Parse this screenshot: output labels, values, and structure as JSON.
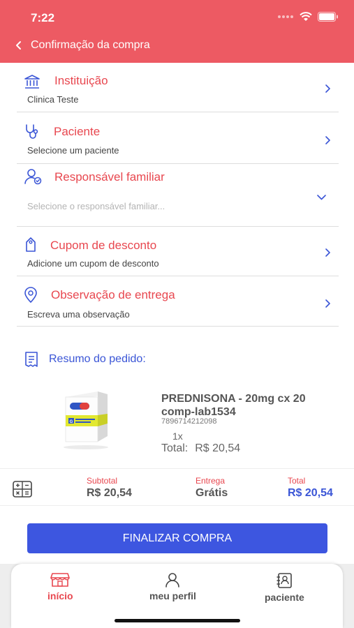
{
  "status_bar": {
    "time": "7:22"
  },
  "header": {
    "title": "Confirmação da compra"
  },
  "sections": {
    "institution": {
      "title": "Instituição",
      "value": "Clinica Teste"
    },
    "patient": {
      "title": "Paciente",
      "value": "Selecione um paciente"
    },
    "guardian": {
      "title": "Responsável familiar",
      "placeholder": "Selecione o responsável familiar..."
    },
    "coupon": {
      "title": "Cupom de desconto",
      "value": "Adicione um cupom de desconto"
    },
    "delivery_note": {
      "title": "Observação de entrega",
      "value": "Escreva uma observação"
    }
  },
  "summary": {
    "title": "Resumo do pedido:",
    "product": {
      "name": "PREDNISONA - 20mg cx 20 comp-lab1534",
      "code": "7896714212098",
      "quantity": "1x",
      "total_label": "Total:",
      "total_value": "R$ 20,54"
    }
  },
  "totals": {
    "subtotal_label": "Subtotal",
    "subtotal_value": "R$ 20,54",
    "delivery_label": "Entrega",
    "delivery_value": "Grátis",
    "total_label": "Total",
    "total_value": "R$ 20,54"
  },
  "actions": {
    "finish_label": "FINALIZAR COMPRA"
  },
  "tabbar": {
    "items": [
      {
        "label": "início",
        "icon": "store-icon",
        "active": true
      },
      {
        "label": "meu perfil",
        "icon": "user-icon",
        "active": false
      },
      {
        "label": "paciente",
        "icon": "patient-card-icon",
        "active": false
      }
    ]
  },
  "colors": {
    "header": "#ed5a63",
    "accent_red": "#e8474f",
    "accent_blue": "#3d56e0"
  }
}
